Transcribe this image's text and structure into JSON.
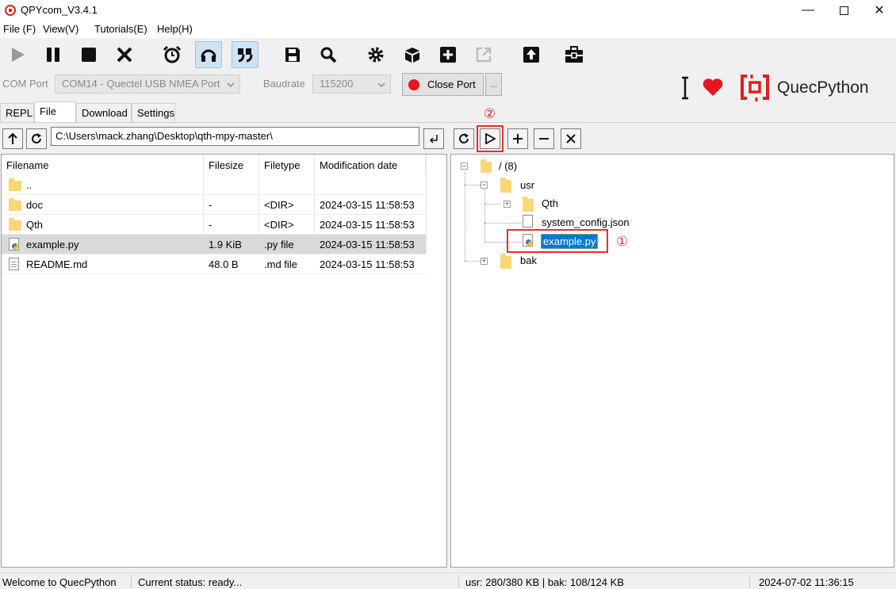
{
  "window": {
    "title": "QPYcom_V3.4.1"
  },
  "menu": [
    "File (F)",
    "View(V)",
    "Tutorials(E)",
    "Help(H)"
  ],
  "toolbar_icons": [
    "play-icon",
    "pause-icon",
    "stop-icon",
    "close-x-icon",
    "alarm-clock-icon",
    "headset-icon",
    "quote-icon",
    "save-icon",
    "search-icon",
    "gear-icon",
    "cube-icon",
    "plus-square-icon",
    "external-link-icon",
    "upload-icon",
    "toolbox-icon"
  ],
  "connection": {
    "com_port_label": "COM Port",
    "com_port_value": "COM14 - Quectel USB NMEA Port",
    "baudrate_label": "Baudrate",
    "baudrate_value": "115200",
    "close_port_label": "Close Port",
    "more_label": "..."
  },
  "brand": {
    "name": "QuecPython"
  },
  "tabs": [
    "REPL",
    "File",
    "Download",
    "Settings"
  ],
  "left": {
    "path": "C:\\Users\\mack.zhang\\Desktop\\qth-mpy-master\\",
    "columns": [
      "Filename",
      "Filesize",
      "Filetype",
      "Modification date"
    ],
    "rows": [
      {
        "name": "..",
        "size": "",
        "type": "",
        "date": "",
        "icon": "folder"
      },
      {
        "name": "doc",
        "size": "-",
        "type": "<DIR>",
        "date": "2024-03-15 11:58:53",
        "icon": "folder"
      },
      {
        "name": "Qth",
        "size": "-",
        "type": "<DIR>",
        "date": "2024-03-15 11:58:53",
        "icon": "folder"
      },
      {
        "name": "example.py",
        "size": "1.9 KiB",
        "type": ".py file",
        "date": "2024-03-15 11:58:53",
        "icon": "python"
      },
      {
        "name": "README.md",
        "size": "48.0 B",
        "type": ".md file",
        "date": "2024-03-15 11:58:53",
        "icon": "doc"
      }
    ]
  },
  "right": {
    "root": "/ (8)",
    "usr": "usr",
    "qth": "Qth",
    "config": "system_config.json",
    "example": "example.py",
    "bak": "bak"
  },
  "annotations": {
    "one": "①",
    "two": "②"
  },
  "status": {
    "welcome": "Welcome to QuecPython",
    "current": "Current status: ready...",
    "storage": "usr: 280/380 KB | bak: 108/124 KB",
    "datetime": "2024-07-02 11:36:15"
  },
  "colors": {
    "accent_red": "#e03030",
    "selection_blue": "#0078d7",
    "brand_red": "#e02020"
  }
}
